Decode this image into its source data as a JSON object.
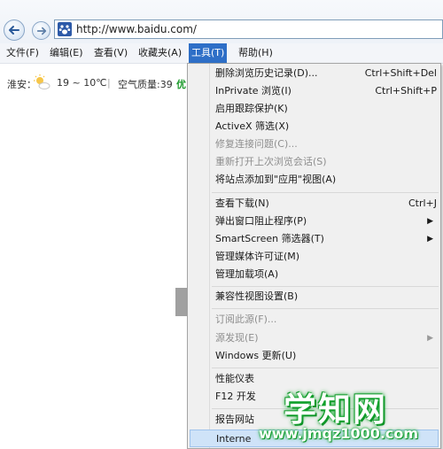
{
  "toolbar": {
    "back_icon": "back-arrow-icon",
    "forward_icon": "forward-arrow-icon",
    "address_url": "http://www.baidu.com/",
    "site_icon": "baidu-paw-icon"
  },
  "menubar": {
    "file": "文件(F)",
    "edit": "编辑(E)",
    "view": "查看(V)",
    "favorites": "收藏夹(A)",
    "tools": "工具(T)",
    "help": "帮助(H)"
  },
  "weather": {
    "city": "淮安：",
    "temp": "19 ~ 10℃",
    "divider": "|",
    "aq_label": "空气质量:39",
    "aq_status": "优",
    "icon": "partly-sunny-icon"
  },
  "tools_menu": {
    "delete_history": {
      "label": "删除浏览历史记录(D)...",
      "shortcut": "Ctrl+Shift+Del"
    },
    "inprivate": {
      "label": "InPrivate 浏览(I)",
      "shortcut": "Ctrl+Shift+P"
    },
    "tracking_protection": {
      "label": "启用跟踪保护(K)"
    },
    "activex": {
      "label": "ActiveX 筛选(X)"
    },
    "fix_connection": {
      "label": "修复连接问题(C)..."
    },
    "reopen_session": {
      "label": "重新打开上次浏览会话(S)"
    },
    "add_site_apps": {
      "label": "将站点添加到\"应用\"视图(A)"
    },
    "view_downloads": {
      "label": "查看下载(N)",
      "shortcut": "Ctrl+J"
    },
    "popup_blocker": {
      "label": "弹出窗口阻止程序(P)"
    },
    "smartscreen": {
      "label": "SmartScreen 筛选器(T)"
    },
    "media_license": {
      "label": "管理媒体许可证(M)"
    },
    "manage_addons": {
      "label": "管理加载项(A)"
    },
    "compat_view": {
      "label": "兼容性视图设置(B)"
    },
    "subscribe_feed": {
      "label": "订阅此源(F)..."
    },
    "feed_discovery": {
      "label": "源发现(E)"
    },
    "windows_update": {
      "label": "Windows 更新(U)"
    },
    "performance": {
      "label": "性能仪表"
    },
    "f12_tools": {
      "label": "F12 开发"
    },
    "report_site": {
      "label": "报告网站"
    },
    "internet_options": {
      "label": "Interne"
    }
  },
  "watermark": {
    "brand": "学知网",
    "url": "www.jmqz1000.com"
  }
}
